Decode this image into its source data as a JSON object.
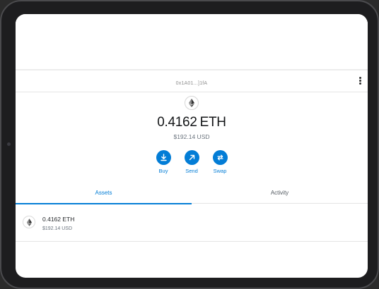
{
  "account": {
    "address": "0x1A01...]1fA",
    "menu_icon": "kebab-menu-icon"
  },
  "balance": {
    "amount": "0.4162",
    "unit": "ETH",
    "fiat": "$192.14 USD",
    "token_icon": "ethereum-icon"
  },
  "actions": [
    {
      "label": "Buy",
      "icon": "download-icon"
    },
    {
      "label": "Send",
      "icon": "arrow-up-right-icon"
    },
    {
      "label": "Swap",
      "icon": "swap-arrows-icon"
    }
  ],
  "tabs": [
    {
      "label": "Assets",
      "active": true
    },
    {
      "label": "Activity",
      "active": false
    }
  ],
  "assets": [
    {
      "amount": "0.4162 ETH",
      "fiat": "$192.14 USD",
      "icon": "ethereum-icon"
    }
  ],
  "colors": {
    "accent": "#037dd6",
    "text_primary": "#141618",
    "text_secondary": "#6a737d"
  }
}
